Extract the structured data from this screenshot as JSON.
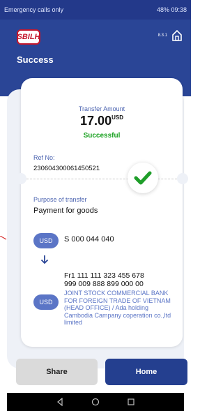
{
  "status_bar": {
    "left_text": "Emergency calls only",
    "right_text": "48% 09:38"
  },
  "header": {
    "logo_text": "SBILH",
    "version": "8.3.1",
    "title": "Success"
  },
  "receipt": {
    "amount_label": "Transfer Amount",
    "amount": "17.00",
    "currency_superscript": "USD",
    "status": "Successful",
    "ref_label": "Ref No:",
    "ref_value": "230604300061450521",
    "purpose_label": "Purpose of transfer",
    "purpose_value": "Payment for goods",
    "from": {
      "currency": "USD",
      "account": "S 000 044 040"
    },
    "to": {
      "currency": "USD",
      "account_line1": "Fr1 111 111 323 455 678",
      "account_line2": "999 009 888 899 000 00",
      "bank_name": "JOINT STOCK COMMERCIAL BANK FOR FOREIGN TRADE OF VIETNAM (HEAD OFFICE) / Ada holding Cambodia Campany coperation co.,ltd limited"
    }
  },
  "actions": {
    "share_label": "Share",
    "home_label": "Home"
  },
  "colors": {
    "brand_blue": "#2a4596",
    "accent_blue": "#5b75c6",
    "success_green": "#18a01f",
    "logo_red": "#c4172d"
  },
  "icons": {
    "home": "home-icon",
    "success": "check-icon",
    "transfer_direction": "arrow-down-icon",
    "nav_back": "back-triangle-icon",
    "nav_home": "circle-icon",
    "nav_recents": "square-icon"
  }
}
